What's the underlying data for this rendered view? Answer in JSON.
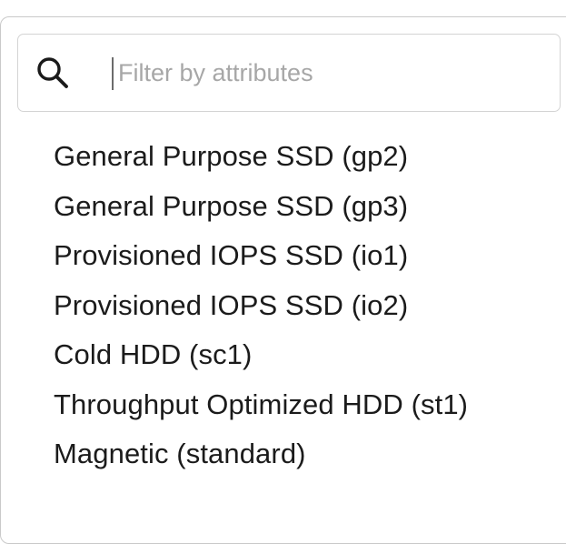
{
  "filter": {
    "placeholder": "Filter by attributes",
    "value": "",
    "icon": "search-icon"
  },
  "options": [
    {
      "label": "General Purpose SSD (gp2)"
    },
    {
      "label": "General Purpose SSD (gp3)"
    },
    {
      "label": "Provisioned IOPS SSD (io1)"
    },
    {
      "label": "Provisioned IOPS SSD (io2)"
    },
    {
      "label": "Cold HDD (sc1)"
    },
    {
      "label": "Throughput Optimized HDD (st1)"
    },
    {
      "label": "Magnetic (standard)"
    }
  ]
}
